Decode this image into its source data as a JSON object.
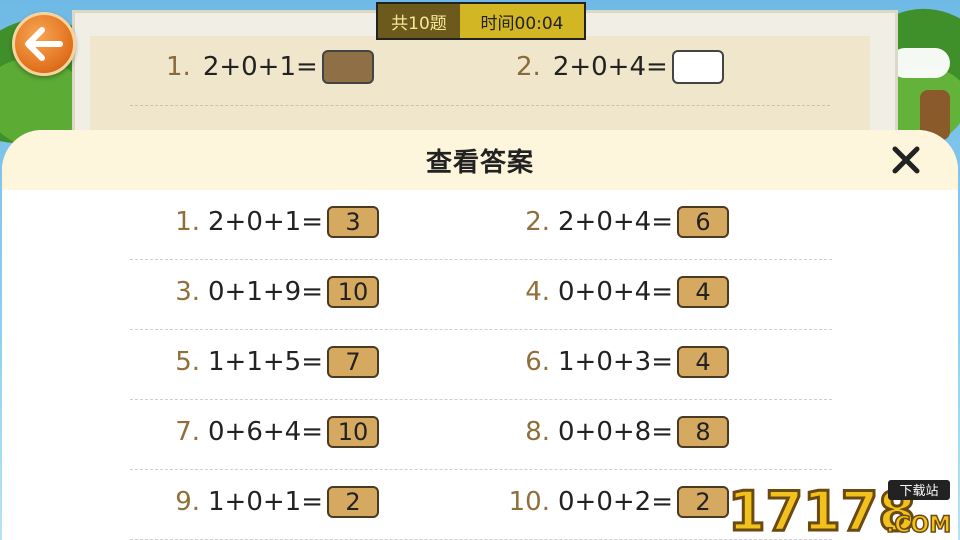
{
  "header": {
    "count": "共10题",
    "time": "时间00:04"
  },
  "background_questions": [
    {
      "num": "1.",
      "expr": "2+0+1=",
      "filled": true
    },
    {
      "num": "2.",
      "expr": "2+0+4=",
      "filled": false
    }
  ],
  "modal": {
    "title": "查看答案",
    "items": [
      {
        "num": "1.",
        "expr": "2+0+1=",
        "answer": "3"
      },
      {
        "num": "2.",
        "expr": "2+0+4=",
        "answer": "6"
      },
      {
        "num": "3.",
        "expr": "0+1+9=",
        "answer": "10"
      },
      {
        "num": "4.",
        "expr": "0+0+4=",
        "answer": "4"
      },
      {
        "num": "5.",
        "expr": "1+1+5=",
        "answer": "7"
      },
      {
        "num": "6.",
        "expr": "1+0+3=",
        "answer": "4"
      },
      {
        "num": "7.",
        "expr": "0+6+4=",
        "answer": "10"
      },
      {
        "num": "8.",
        "expr": "0+0+8=",
        "answer": "8"
      },
      {
        "num": "9.",
        "expr": "1+0+1=",
        "answer": "2"
      },
      {
        "num": "10.",
        "expr": "0+0+2=",
        "answer": "2"
      }
    ]
  },
  "watermark": {
    "text": "17178",
    "suffix": ".COM",
    "tag": "下载站"
  },
  "colors": {
    "accent": "#d5a95f",
    "header_time": "#d3b624",
    "back_button": "#e2731f"
  }
}
